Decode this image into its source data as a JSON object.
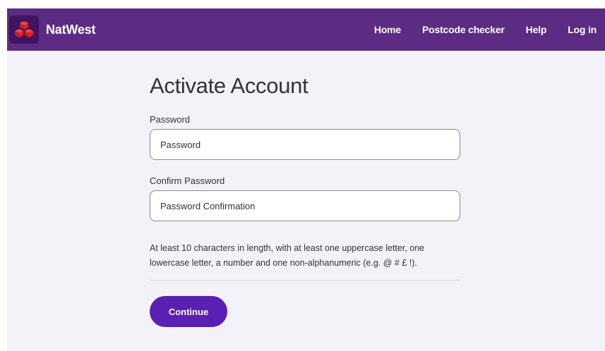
{
  "brand": {
    "name": "NatWest",
    "logo_icon": "natwest-cubes-logo",
    "logo_color": "#e3242b"
  },
  "nav": {
    "items": [
      {
        "label": "Home"
      },
      {
        "label": "Postcode checker"
      },
      {
        "label": "Help"
      },
      {
        "label": "Log in"
      }
    ]
  },
  "form": {
    "title": "Activate Account",
    "password": {
      "label": "Password",
      "placeholder": "Password",
      "value": ""
    },
    "confirm_password": {
      "label": "Confirm Password",
      "placeholder": "Password Confirmation",
      "value": ""
    },
    "hint_line1": "At least 10 characters in length, with at least one uppercase letter, one",
    "hint_line2": "lowercase letter, a number and one non-alphanumeric (e.g. @ # £ !).",
    "submit_label": "Continue"
  },
  "colors": {
    "header_bg": "#5c2b83",
    "page_bg": "#f2f2f8",
    "button_bg": "#5a1fb3"
  }
}
